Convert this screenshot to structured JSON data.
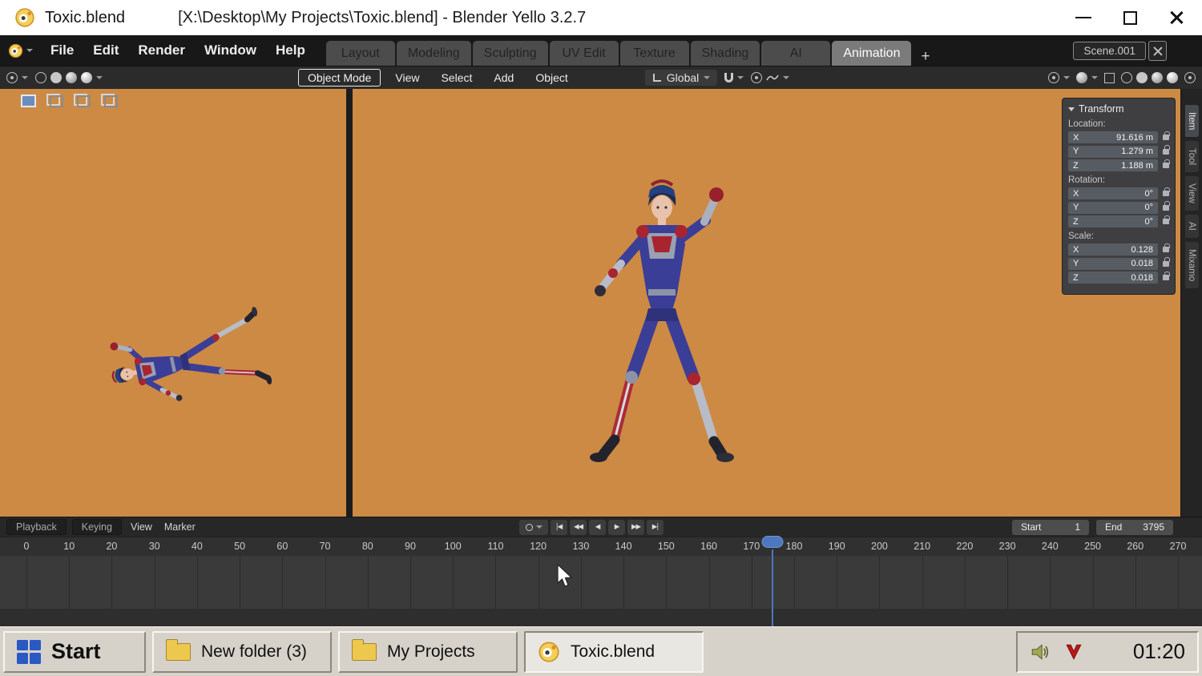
{
  "titlebar": {
    "title": "Toxic.blend",
    "path": "[X:\\Desktop\\My Projects\\Toxic.blend] - Blender Yello 3.2.7"
  },
  "menubar": {
    "menus": [
      "File",
      "Edit",
      "Render",
      "Window",
      "Help"
    ],
    "workspaces": [
      "Layout",
      "Modeling",
      "Sculpting",
      "UV Edit",
      "Texture",
      "Shading",
      "AI",
      "Animation"
    ],
    "active_workspace": "Animation",
    "new_workspace_label": "+",
    "scene_name": "Scene.001"
  },
  "toolbar": {
    "mode_label": "Object Mode",
    "menus": [
      "View",
      "Select",
      "Add",
      "Object"
    ],
    "orientation_label": "Global"
  },
  "viewport": {
    "background_color": "#cd8a44",
    "suit_blue": "#3b3e96",
    "accent_red": "#a8242f"
  },
  "sidebar": {
    "panel_title": "Transform",
    "location_label": "Location:",
    "rotation_label": "Rotation:",
    "scale_label": "Scale:",
    "location": [
      {
        "axis": "X",
        "value": "91.616 m"
      },
      {
        "axis": "Y",
        "value": "1.279 m"
      },
      {
        "axis": "Z",
        "value": "1.188 m"
      }
    ],
    "rotation": [
      {
        "axis": "X",
        "value": "0°"
      },
      {
        "axis": "Y",
        "value": "0°"
      },
      {
        "axis": "Z",
        "value": "0°"
      }
    ],
    "scale": [
      {
        "axis": "X",
        "value": "0.128"
      },
      {
        "axis": "Y",
        "value": "0.018"
      },
      {
        "axis": "Z",
        "value": "0.018"
      }
    ],
    "tabs": [
      "Item",
      "Tool",
      "View",
      "AI",
      "Mixamo"
    ],
    "active_tab": "Item"
  },
  "timeline": {
    "menus": [
      "Playback",
      "Keying",
      "View",
      "Marker"
    ],
    "transport": [
      "|◀",
      "◀◀",
      "◀",
      "▶",
      "▶▶",
      "▶|"
    ],
    "ticks": [
      0,
      10,
      20,
      30,
      40,
      50,
      60,
      70,
      80,
      90,
      100,
      110,
      120,
      130,
      140,
      150,
      160,
      170,
      180,
      190,
      200,
      210,
      220,
      230,
      240,
      250,
      260,
      270
    ],
    "current_frame": 175,
    "start_label": "Start",
    "start_value": "1",
    "end_label": "End",
    "end_value": "3795"
  },
  "taskbar": {
    "start_label": "Start",
    "buttons": [
      {
        "label": "New folder (3)",
        "active": false
      },
      {
        "label": "My Projects",
        "active": false
      },
      {
        "label": "Toxic.blend",
        "active": true
      }
    ],
    "clock": "01:20"
  }
}
